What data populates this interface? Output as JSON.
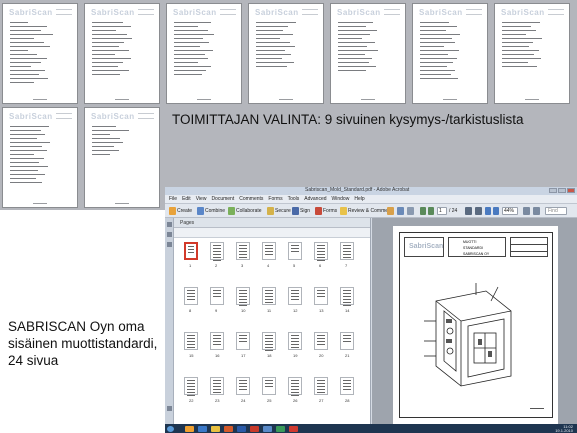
{
  "slide": {
    "caption_top": "TOIMITTAJAN VALINTA: 9 sivuinen kysymys-/tarkistuslista",
    "caption_left": "SABRISCAN Oyn oma sisäinen muottistandardi, 24 sivua"
  },
  "document_pages": {
    "logo": "SabriScan",
    "count": 9
  },
  "pdf_window": {
    "title": "Sabriscan_Mold_Standard.pdf - Adobe Acrobat",
    "menu": [
      "File",
      "Edit",
      "View",
      "Document",
      "Comments",
      "Forms",
      "Tools",
      "Advanced",
      "Window",
      "Help"
    ],
    "toolbar": {
      "create": "Create",
      "combine": "Combine",
      "collaborate": "Collaborate",
      "secure": "Secure",
      "sign": "Sign",
      "forms": "Forms",
      "review": "Review & Comment",
      "page_current": "1",
      "page_total": "/ 24",
      "zoom": "44%",
      "find": "Find"
    },
    "panel_title": "Pages",
    "page_numbers": [
      "1",
      "2",
      "3",
      "4",
      "5",
      "6",
      "7",
      "8",
      "9",
      "10",
      "11",
      "12",
      "13",
      "14",
      "15",
      "16",
      "17",
      "18",
      "19",
      "20",
      "21",
      "22",
      "23",
      "24",
      "25",
      "26",
      "27",
      "28"
    ],
    "drawing": {
      "logo": "SabriScan",
      "title_block": [
        "MUOTTI",
        "STANDARDI",
        "SABRISCAN OY"
      ]
    },
    "taskbar": {
      "time": "11:02",
      "date": "19.1.2010"
    }
  },
  "colors": {
    "band": "#b4b6bc",
    "taskbar": "#1e3550",
    "selected_thumb": "#d23a2a"
  }
}
